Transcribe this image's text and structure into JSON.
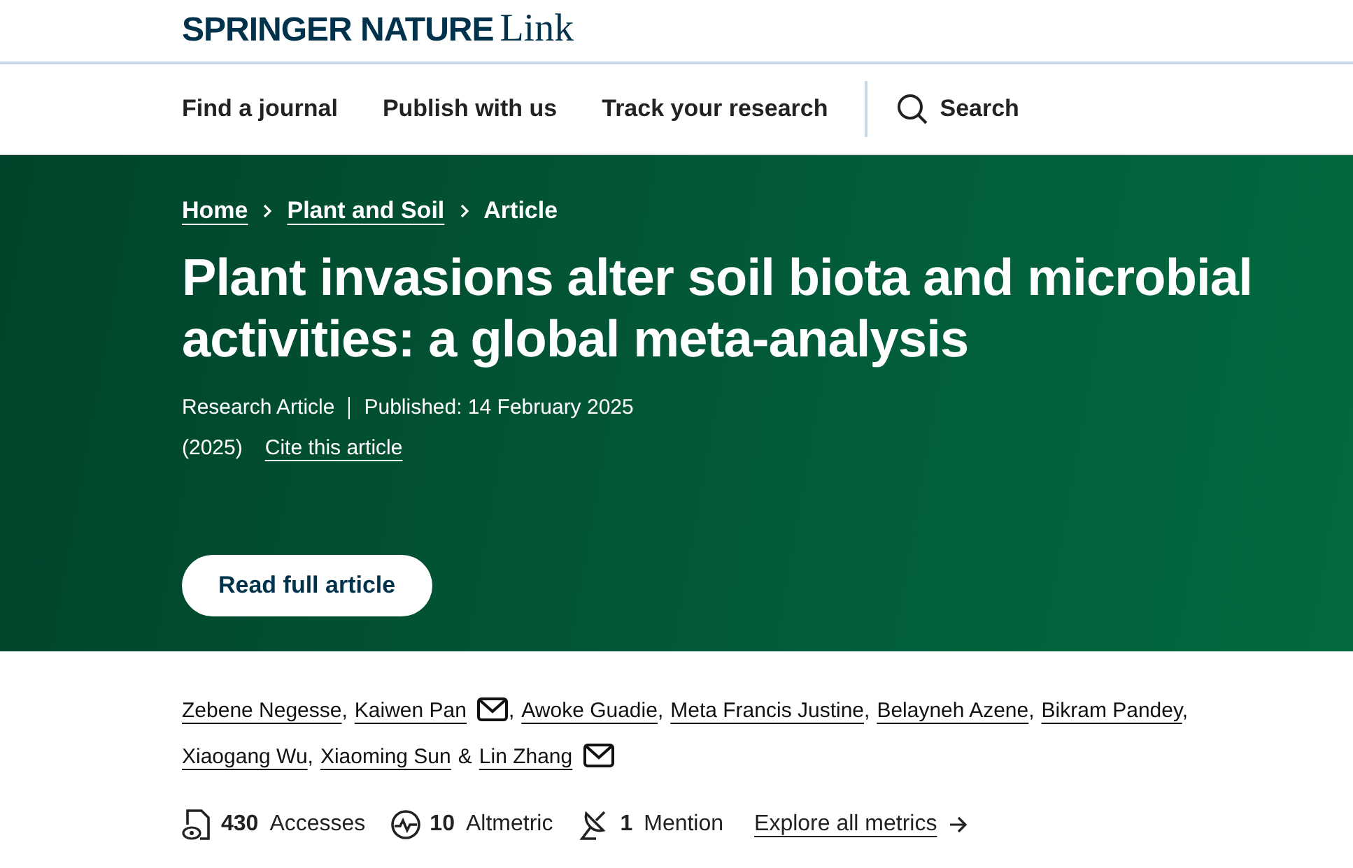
{
  "logo": {
    "brand": "SPRINGER NATURE",
    "product": "Link"
  },
  "nav": [
    {
      "label": "Find a journal"
    },
    {
      "label": "Publish with us"
    },
    {
      "label": "Track your research"
    }
  ],
  "search": {
    "label": "Search"
  },
  "breadcrumbs": [
    {
      "label": "Home",
      "link": true
    },
    {
      "label": "Plant and Soil",
      "link": true
    },
    {
      "label": "Article",
      "link": false
    }
  ],
  "title": "Plant invasions alter soil biota and microbial activities: a global meta-analysis",
  "article_type": "Research Article",
  "published": "Published: 14 February 2025",
  "year": "(2025)",
  "cite": "Cite this article",
  "read_button": "Read full article",
  "authors": [
    {
      "name": "Zebene Negesse",
      "email": false,
      "sep": ","
    },
    {
      "name": "Kaiwen Pan",
      "email": true,
      "sep": ","
    },
    {
      "name": "Awoke Guadie",
      "email": false,
      "sep": ","
    },
    {
      "name": "Meta Francis Justine",
      "email": false,
      "sep": ","
    },
    {
      "name": "Belayneh Azene",
      "email": false,
      "sep": ","
    },
    {
      "name": "Bikram Pandey",
      "email": false,
      "sep": ","
    },
    {
      "name": "Xiaogang Wu",
      "email": false,
      "sep": ","
    },
    {
      "name": "Xiaoming Sun",
      "email": false,
      "sep": "&"
    },
    {
      "name": "Lin Zhang",
      "email": true
    }
  ],
  "metrics": [
    {
      "kind": "accesses",
      "value": "430",
      "label": "Accesses"
    },
    {
      "kind": "altmetric",
      "value": "10",
      "label": "Altmetric"
    },
    {
      "kind": "mention",
      "value": "1",
      "label": "Mention"
    }
  ],
  "explore": "Explore all metrics"
}
